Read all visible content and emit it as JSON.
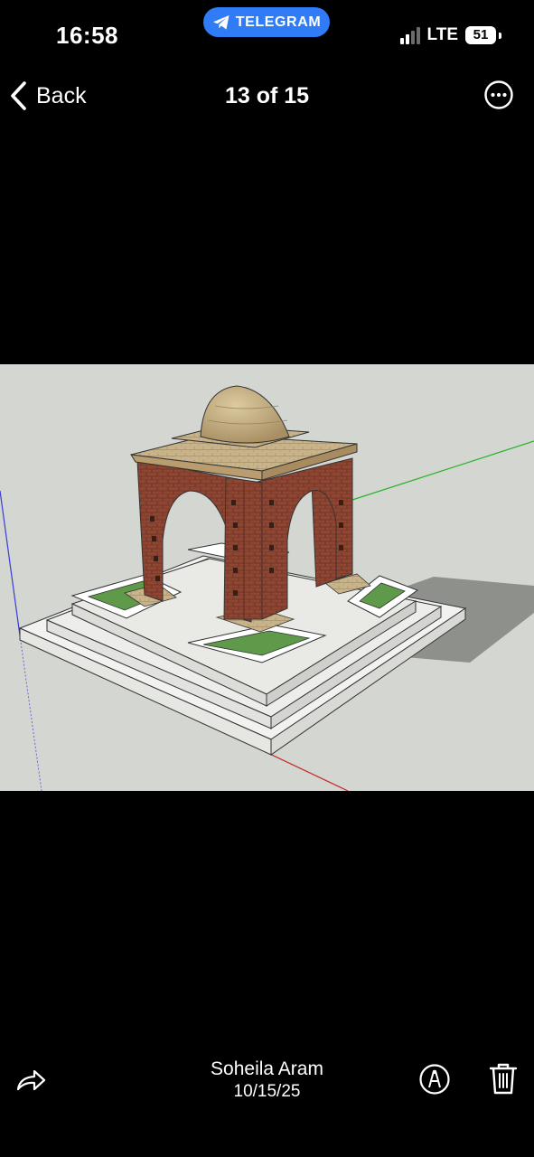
{
  "status_bar": {
    "time": "16:58",
    "return_app": "TELEGRAM",
    "network": "LTE",
    "battery": "51",
    "signal_bars_active": 2,
    "signal_bars_total": 4
  },
  "nav": {
    "back_label": "Back",
    "title": "13 of 15"
  },
  "footer": {
    "author": "Soheila Aram",
    "date": "10/15/25"
  },
  "icons": {
    "back": "chevron-left-icon",
    "more": "ellipsis-circle-icon",
    "share": "share-arrow-icon",
    "markup": "markup-pen-icon",
    "delete": "trash-icon",
    "telegram": "paper-plane-icon"
  },
  "colors": {
    "background": "#000000",
    "telegram_pill": "#2f7cf6",
    "photo_background": "#d3d6d1",
    "brick": "#8e4632",
    "stone": "#c9b184",
    "grass": "#5f9a4a"
  }
}
